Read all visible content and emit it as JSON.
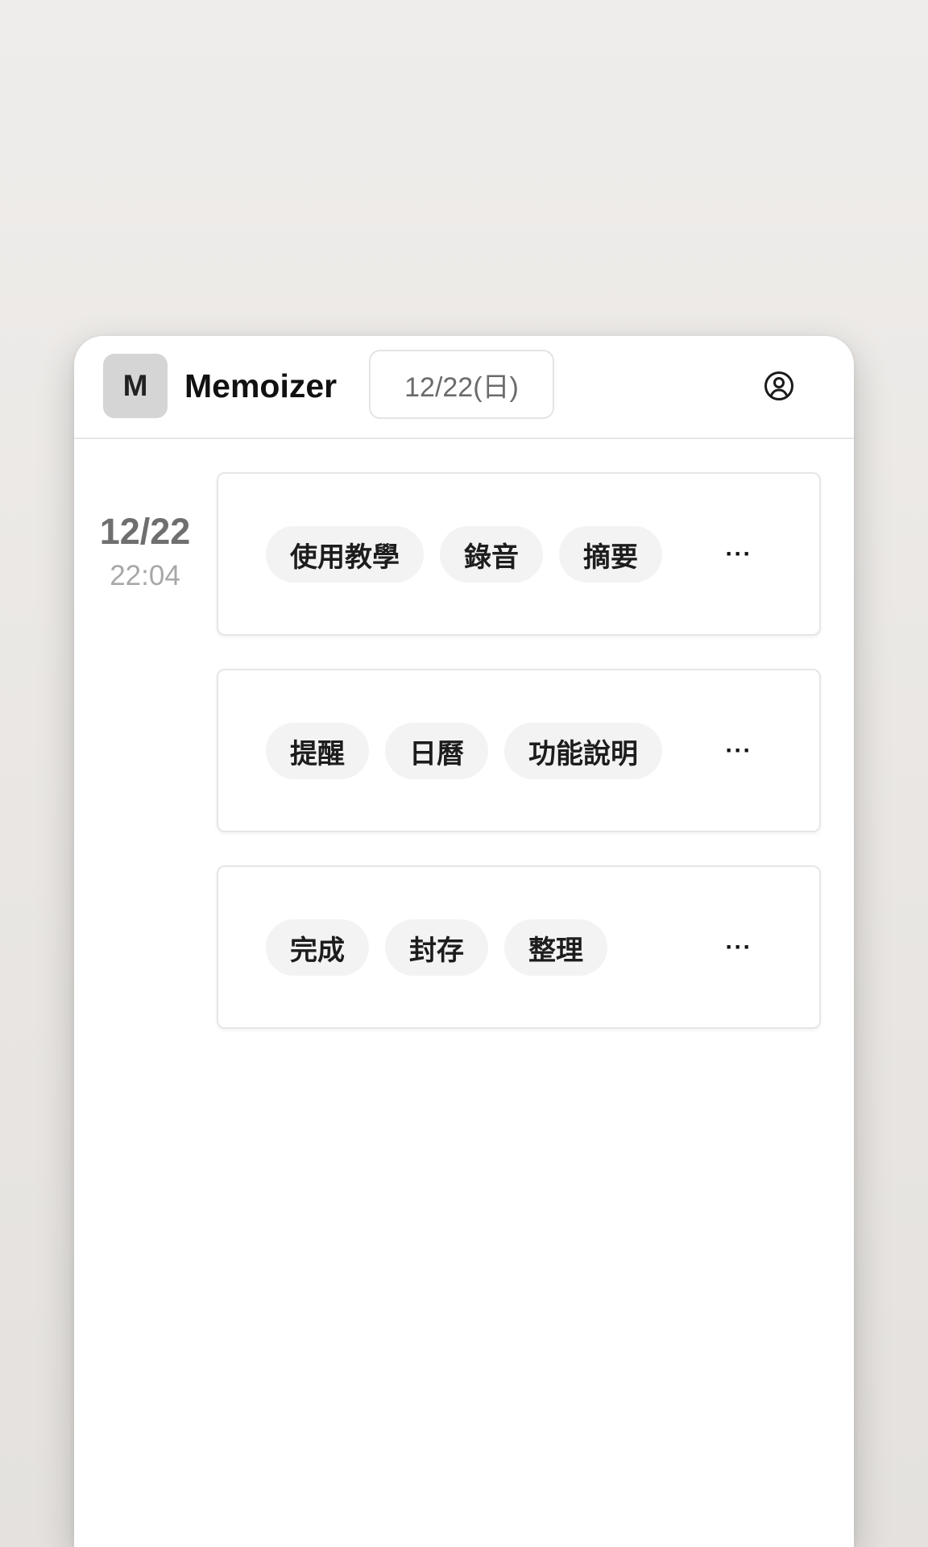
{
  "app": {
    "logo_letter": "M",
    "title": "Memoizer"
  },
  "header": {
    "date_label": "12/22(日)",
    "account_icon": "user-circle-icon"
  },
  "entry": {
    "date": "12/22",
    "time": "22:04"
  },
  "cards": [
    {
      "tags": [
        "使用教學",
        "錄音",
        "摘要"
      ],
      "more_label": "···"
    },
    {
      "tags": [
        "提醒",
        "日曆",
        "功能說明"
      ],
      "more_label": "···"
    },
    {
      "tags": [
        "完成",
        "封存",
        "整理"
      ],
      "more_label": "···"
    }
  ],
  "colors": {
    "background": "#ebe8e5",
    "card_border": "#e6e6e6",
    "tag_background": "#f3f3f3",
    "logo_background": "#d5d5d5"
  }
}
